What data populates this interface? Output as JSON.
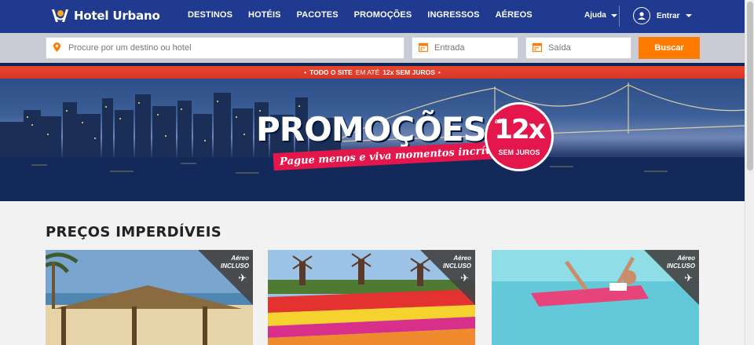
{
  "header": {
    "brand": "Hotel Urbano",
    "nav": [
      "DESTINOS",
      "HOTÉIS",
      "PACOTES",
      "PROMOÇÕES",
      "INGRESSOS",
      "AÉREOS"
    ],
    "help_label": "Ajuda",
    "login_label": "Entrar"
  },
  "search": {
    "destination_placeholder": "Procure por um destino ou hotel",
    "checkin_placeholder": "Entrada",
    "checkout_placeholder": "Saída",
    "button_label": "Buscar"
  },
  "banner": {
    "ribbon_pre": "TODO O SITE",
    "ribbon_mid": "EM ATÉ",
    "ribbon_strong": "12x SEM JUROS",
    "title": "PROMOÇÕES",
    "subtitle": "Pague menos e viva momentos incríveis.",
    "badge_ate": "até",
    "badge_num": "12x",
    "badge_sem": "SEM JUROS"
  },
  "section": {
    "title": "PREÇOS IMPERDÍVEIS"
  },
  "cards": [
    {
      "corner_line1": "Aéreo",
      "corner_line2": "INCLUSO"
    },
    {
      "corner_line1": "Aéreo",
      "corner_line2": "INCLUSO"
    },
    {
      "corner_line1": "Aéreo",
      "corner_line2": "INCLUSO"
    }
  ],
  "colors": {
    "header_blue": "#1f3a8f",
    "accent_orange": "#ff7a00",
    "promo_pink": "#e3174c",
    "ribbon_red": "#e8452e"
  },
  "icons": [
    "logo-icon",
    "chevron-down-icon",
    "user-icon",
    "location-pin-icon",
    "calendar-icon",
    "airplane-icon"
  ]
}
